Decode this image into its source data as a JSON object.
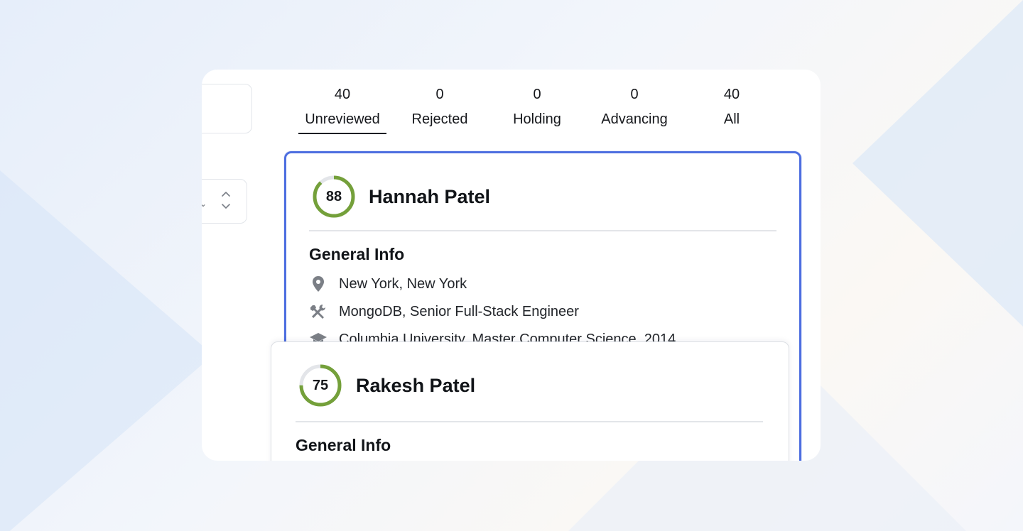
{
  "tabs": [
    {
      "count": "40",
      "label": "Unreviewed",
      "active": true
    },
    {
      "count": "0",
      "label": "Rejected",
      "active": false
    },
    {
      "count": "0",
      "label": "Holding",
      "active": false
    },
    {
      "count": "0",
      "label": "Advancing",
      "active": false
    },
    {
      "count": "40",
      "label": "All",
      "active": false
    }
  ],
  "candidates": [
    {
      "score": "88",
      "score_value": 88,
      "name": "Hannah Patel",
      "section_title": "General Info",
      "location": "New York, New York",
      "job": "MongoDB, Senior Full-Stack Engineer",
      "education": "Columbia University, Master Computer Science, 2014"
    },
    {
      "score": "75",
      "score_value": 75,
      "name": "Rakesh Patel",
      "section_title": "General Info"
    }
  ],
  "icons": {
    "location": "map-pin-icon",
    "job": "tools-icon",
    "education": "graduation-cap-icon"
  },
  "colors": {
    "score_ring": "#74a03a",
    "score_track": "#e3e5e9",
    "selected_border": "#4d6ee0"
  }
}
